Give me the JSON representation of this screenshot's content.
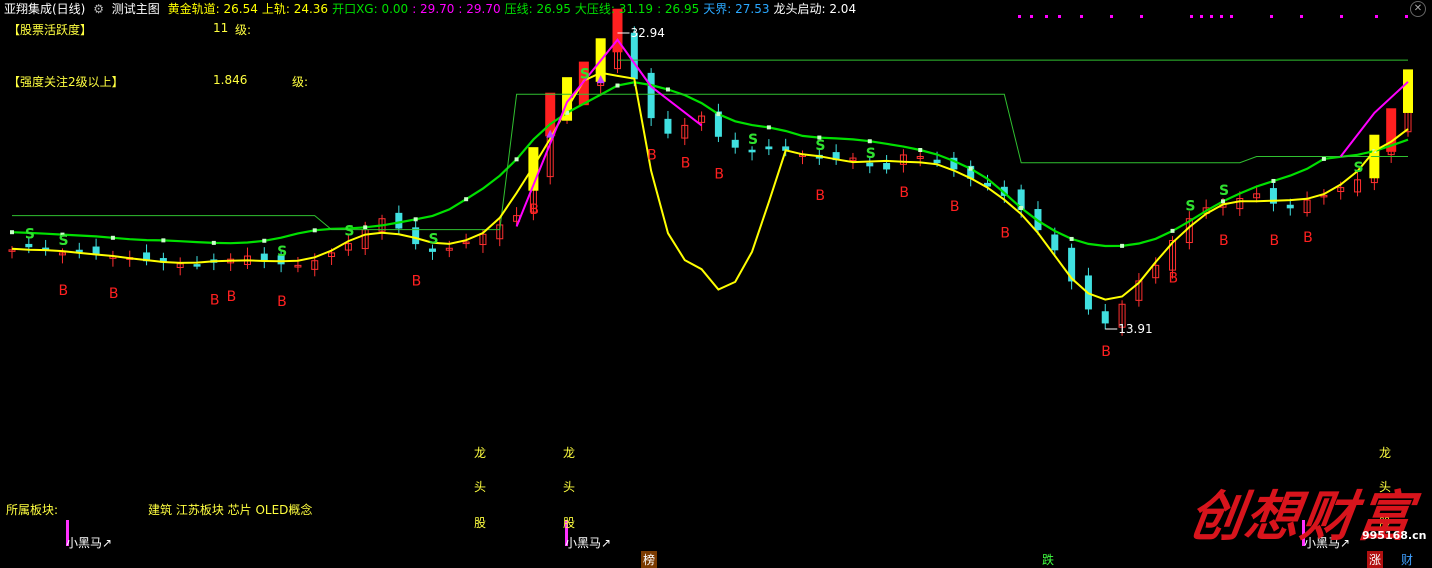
{
  "header": {
    "title": "亚翔集成(日线)",
    "indicator_name": "测试主图",
    "fields": [
      {
        "label": "黄金轨道:",
        "value": "26.54",
        "color": "#ffff00"
      },
      {
        "label": "上轨:",
        "value": "24.36",
        "color": "#ffff00"
      },
      {
        "label": "开口XG:",
        "value": "0.00",
        "color": "#00e000"
      },
      {
        "label": ":",
        "value": "29.70",
        "color": "#ff00ff"
      },
      {
        "label": ":",
        "value": "29.70",
        "color": "#ff00ff"
      },
      {
        "label": "压线:",
        "value": "26.95",
        "color": "#00e000"
      },
      {
        "label": "大压线:",
        "value": "31.19",
        "color": "#00e000"
      },
      {
        "label": ":",
        "value": "26.95",
        "color": "#00e000"
      },
      {
        "label": "天界:",
        "value": "27.53",
        "color": "#2aa8ff"
      },
      {
        "label": "龙头启动:",
        "value": "2.04",
        "color": "#ffffff"
      }
    ]
  },
  "side_labels": {
    "activity_label": "【股票活跃度】",
    "activity_value": "11",
    "activity_unit": "级:",
    "strength_label": "【强度关注2级以上】",
    "strength_value": "1.846",
    "strength_unit": "级:"
  },
  "bottom": {
    "sector_label": "所属板块:",
    "sectors": "建筑 江苏板块 芯片 OLED概念",
    "dark_horse_1": "小黑马↗",
    "dark_horse_2": "小黑马↗",
    "dark_horse_3": "小黑马↗",
    "dragon_chars": [
      "龙",
      "头",
      "股"
    ],
    "tag_bang": "榜",
    "tag_die": "跌",
    "tag_zhang": "涨",
    "tag_cai": "财",
    "watermark": "创想财富",
    "watermark_url": "995168.cn"
  },
  "chart_data": {
    "type": "candlestick",
    "title": "亚翔集成(日线)",
    "price_annotations": [
      {
        "label": "32.94",
        "kind": "high"
      },
      {
        "label": "13.91",
        "kind": "low"
      }
    ],
    "signal_letters": {
      "buy": "B",
      "sell": "S"
    },
    "colors": {
      "up": "#ff3030",
      "down": "#40e0e0",
      "gold_track": "#ffff00",
      "band": "#00e000",
      "magenta": "#ff00ff",
      "dragon": "#ffff00"
    },
    "approx_close_trend": [
      19.0,
      19.2,
      19.0,
      18.8,
      18.9,
      18.7,
      18.6,
      18.5,
      18.3,
      18.2,
      18.1,
      18.0,
      18.2,
      18.4,
      18.6,
      18.3,
      18.1,
      18.0,
      18.3,
      18.8,
      19.4,
      20.3,
      21.0,
      20.4,
      19.4,
      18.9,
      19.1,
      19.5,
      20.0,
      20.6,
      21.2,
      24.0,
      27.5,
      28.5,
      29.5,
      31.0,
      32.9,
      30.0,
      27.5,
      26.5,
      27.0,
      27.6,
      26.3,
      25.6,
      25.3,
      25.5,
      25.4,
      25.1,
      24.9,
      24.8,
      24.9,
      24.4,
      24.2,
      25.1,
      25.0,
      24.6,
      24.2,
      23.6,
      23.1,
      22.5,
      21.6,
      20.3,
      19.0,
      17.0,
      15.2,
      14.3,
      15.5,
      17.0,
      18.0,
      19.6,
      21.0,
      21.7,
      22.0,
      22.3,
      22.6,
      22.0,
      21.7,
      22.2,
      22.5,
      23.0,
      23.5,
      24.8,
      26.5,
      29.0
    ]
  }
}
